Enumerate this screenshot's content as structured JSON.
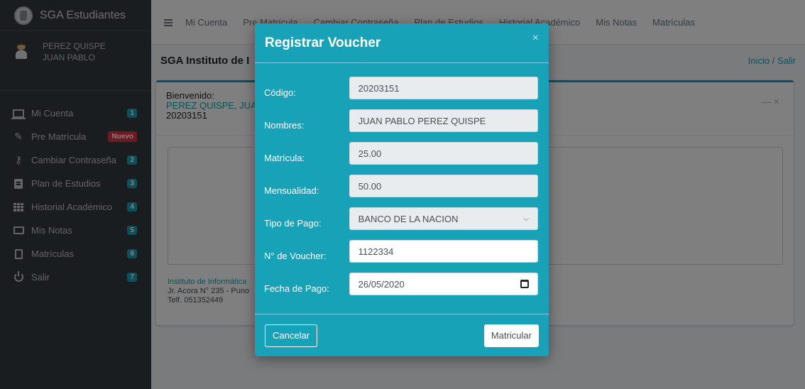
{
  "sidebar": {
    "brand": "SGA Estudiantes",
    "user": {
      "line1": "PEREZ QUISPE",
      "line2": "JUAN PABLO"
    },
    "items": [
      {
        "label": "Mi Cuenta",
        "badge": "1"
      },
      {
        "label": "Pre Matrícula",
        "badge": "Nuevo"
      },
      {
        "label": "Cambiar Contraseña",
        "badge": "2"
      },
      {
        "label": "Plan de Estudios",
        "badge": "3"
      },
      {
        "label": "Historial Académico",
        "badge": "4"
      },
      {
        "label": "Mis Notas",
        "badge": "5"
      },
      {
        "label": "Matrículas",
        "badge": "6"
      },
      {
        "label": "Salir",
        "badge": "7"
      }
    ]
  },
  "topnav": {
    "items": [
      "Mi Cuenta",
      "Pre Matrícula",
      "Cambiar Contraseña",
      "Plan de Estudios",
      "Historial Académico",
      "Mis Notas",
      "Matrículas"
    ]
  },
  "header": {
    "title": "SGA Instituto de I",
    "breadcrumb_home": "Inicio",
    "breadcrumb_sep": " / ",
    "breadcrumb_exit": "Salir"
  },
  "card": {
    "welcome": "Bienvenido:",
    "name": "PEREZ QUISPE, JUA",
    "code": "20203151",
    "tools": "—   ×",
    "footer": {
      "institute": "Instituto de Informática",
      "address": "Jr. Acora N° 235 - Puno",
      "phone": "Telf. 051352449"
    }
  },
  "modal": {
    "title": "Registrar Voucher",
    "close": "×",
    "fields": {
      "codigo": {
        "label": "Código:",
        "value": "20203151"
      },
      "nombres": {
        "label": "Nombres:",
        "value": "JUAN PABLO PEREZ QUISPE"
      },
      "matricula": {
        "label": "Matrícula:",
        "value": "25.00"
      },
      "mensualidad": {
        "label": "Mensualidad:",
        "value": "50.00"
      },
      "tipo_pago": {
        "label": "Tipo de Pago:",
        "value": "BANCO DE LA NACION"
      },
      "voucher": {
        "label": "N° de Voucher:",
        "value": "1122334"
      },
      "fecha": {
        "label": "Fecha de Pago:",
        "value": "26/05/2020"
      }
    },
    "cancel": "Cancelar",
    "submit": "Matricular"
  },
  "colors": {
    "accent": "#17a2b8",
    "sidebar": "#343a40",
    "badge_new": "#dc3545"
  }
}
